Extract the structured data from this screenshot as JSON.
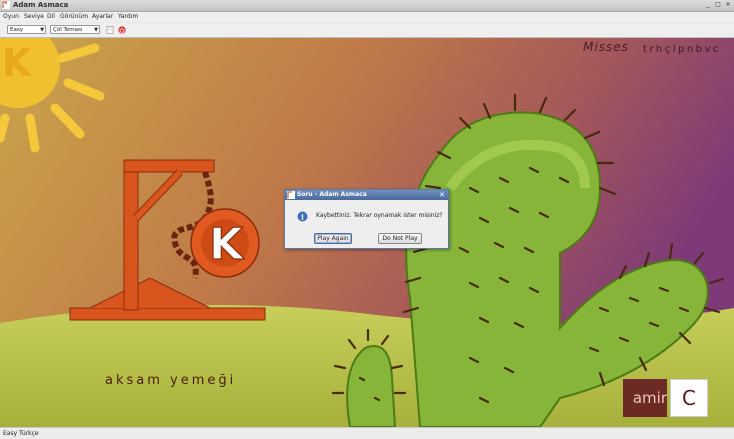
{
  "window": {
    "title": "Adam Asmaca"
  },
  "menu": [
    "Oyun",
    "Seviye",
    "Dil",
    "Görünüm",
    "Ayarlar",
    "Yardım"
  ],
  "toolbar": {
    "level_value": "Easy",
    "theme_value": "Çöl Teması",
    "icons": [
      "new-game-icon",
      "quit-icon"
    ]
  },
  "game": {
    "misses_label": "Misses",
    "misses_letters": "trhçlpnbvc",
    "word": "aksam yemeği",
    "hint_text": "amir",
    "guess_letter": "C"
  },
  "dialog": {
    "title": "Soru - Adam Asmaca",
    "message": "Kaybettiniz. Tekrar oynamak ister misiniz?",
    "play_again": "Play Again",
    "do_not_play": "Do Not Play"
  },
  "status": {
    "text": "Easy Türkçe"
  },
  "colors": {
    "sky_left": "#c8a24a",
    "sky_right": "#7a3c78",
    "ground": "#b9c24a",
    "cactus": "#8ab83c",
    "gallows": "#d8561e"
  }
}
